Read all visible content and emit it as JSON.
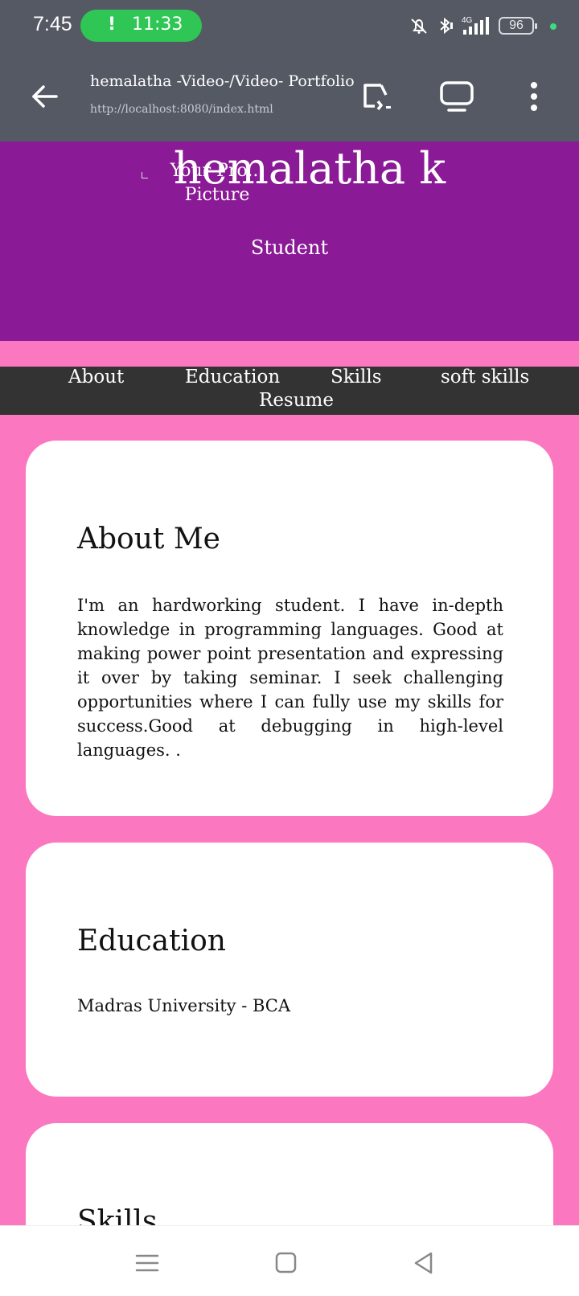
{
  "status_bar": {
    "time": "7:45",
    "pill_icon": "!",
    "pill_time": "11:33",
    "battery": "96",
    "icons": [
      "mute-bell-icon",
      "bluetooth-icon",
      "4g-signal-icon",
      "battery-icon"
    ]
  },
  "app_bar": {
    "title": "hemalatha -Video-/Video- Portfolio",
    "url": "http://localhost:8080/index.html"
  },
  "header": {
    "profile_alt": "Your Pro... Picture",
    "name": "hemalatha k",
    "role": "Student"
  },
  "nav": {
    "items": [
      "About",
      "Education",
      "Skills",
      "soft skills",
      "Resume"
    ]
  },
  "sections": {
    "about": {
      "heading": "About Me",
      "text": "I'm an hardworking student. I have in-depth knowledge in programming languages. Good at making power point presentation and expressing it over by taking seminar. I seek challenging opportunities where I can fully use my skills for success.Good at debugging in high-level languages. ."
    },
    "education": {
      "heading": "Education",
      "text": "Madras University - BCA"
    },
    "skills": {
      "heading": "Skills"
    }
  },
  "colors": {
    "page_bg": "#fb78c1",
    "header_bg": "#8a1a96",
    "nav_bg": "#333333",
    "chrome_bg": "#545963",
    "pill_green": "#2fc655"
  }
}
